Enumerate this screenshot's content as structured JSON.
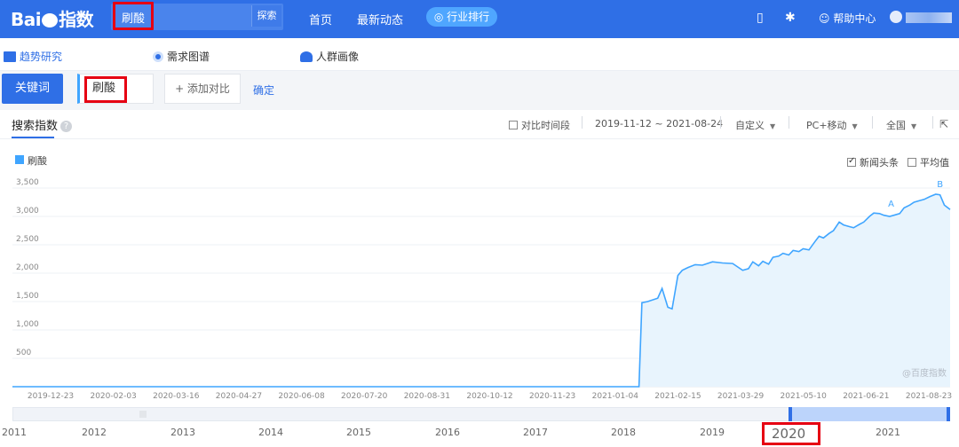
{
  "brand": {
    "logo_text": "Bai",
    "logo_suffix": "指数"
  },
  "search": {
    "value": "刷酸",
    "placeholder": "",
    "button": "探索"
  },
  "nav": {
    "home": "首页",
    "news": "最新动态",
    "rank": "行业排行",
    "help": "帮助中心"
  },
  "tabs": {
    "trend": "趋势研究",
    "demand": "需求图谱",
    "crowd": "人群画像"
  },
  "keyword_row": {
    "kw_label": "关键词",
    "kw_value": "刷酸",
    "add_compare": "+ 添加对比",
    "confirm": "确定"
  },
  "index": {
    "title": "搜索指数",
    "compare_period": "对比时间段",
    "date_range": "2019-11-12 ~ 2021-08-24",
    "custom": "自定义",
    "device": "PC+移动",
    "region": "全国"
  },
  "legend": {
    "series": "刷酸",
    "news_opt": "新闻头条",
    "avg_opt": "平均值",
    "news_checked": true,
    "avg_checked": false
  },
  "watermark": "@百度指数",
  "timeline": {
    "years": [
      "2011",
      "2012",
      "2013",
      "2014",
      "2015",
      "2016",
      "2017",
      "2018",
      "2019",
      "2020",
      "2021"
    ],
    "highlight_year": "2020"
  },
  "colors": {
    "brand_blue": "#2f6fe6",
    "series": "#3fa5ff",
    "highlight": "#e60012"
  },
  "chart_data": {
    "type": "area",
    "ylim": [
      0,
      3500
    ],
    "yticks": [
      500,
      1000,
      1500,
      2000,
      2500,
      3000,
      3500
    ],
    "ytick_labels": [
      "500",
      "1,000",
      "1,500",
      "2,000",
      "2,500",
      "3,000",
      "3,500"
    ],
    "xtick_labels": [
      "2019-12-23",
      "2020-02-03",
      "2020-03-16",
      "2020-04-27",
      "2020-06-08",
      "2020-07-20",
      "2020-08-31",
      "2020-10-12",
      "2020-11-23",
      "2021-01-04",
      "2021-02-15",
      "2021-03-29",
      "2021-05-10",
      "2021-06-21",
      "2021-08-23"
    ],
    "annotations": [
      {
        "label": "A",
        "x": "2021-07-14",
        "y": 3050
      },
      {
        "label": "B",
        "x": "2021-08-17",
        "y": 3390
      }
    ],
    "series": [
      {
        "name": "刷酸",
        "x": [
          "2019-11-12",
          "2020-01-01",
          "2020-03-01",
          "2020-05-01",
          "2020-07-01",
          "2020-09-01",
          "2020-11-01",
          "2021-01-01",
          "2021-01-15",
          "2021-01-20",
          "2021-01-22",
          "2021-01-26",
          "2021-02-02",
          "2021-02-05",
          "2021-02-09",
          "2021-02-12",
          "2021-02-16",
          "2021-02-19",
          "2021-02-23",
          "2021-02-28",
          "2021-03-05",
          "2021-03-12",
          "2021-03-19",
          "2021-03-26",
          "2021-04-02",
          "2021-04-06",
          "2021-04-09",
          "2021-04-13",
          "2021-04-16",
          "2021-04-20",
          "2021-04-23",
          "2021-04-27",
          "2021-04-30",
          "2021-05-04",
          "2021-05-07",
          "2021-05-11",
          "2021-05-14",
          "2021-05-18",
          "2021-05-22",
          "2021-05-25",
          "2021-05-28",
          "2021-06-01",
          "2021-06-04",
          "2021-06-08",
          "2021-06-11",
          "2021-06-15",
          "2021-06-18",
          "2021-06-22",
          "2021-06-25",
          "2021-06-29",
          "2021-07-02",
          "2021-07-06",
          "2021-07-09",
          "2021-07-13",
          "2021-07-16",
          "2021-07-20",
          "2021-07-23",
          "2021-07-27",
          "2021-07-30",
          "2021-08-03",
          "2021-08-06",
          "2021-08-10",
          "2021-08-14",
          "2021-08-17",
          "2021-08-20",
          "2021-08-24"
        ],
        "values": [
          0,
          0,
          0,
          0,
          0,
          0,
          0,
          0,
          0,
          0,
          1480,
          1500,
          1560,
          1730,
          1400,
          1370,
          1960,
          2050,
          2100,
          2150,
          2140,
          2200,
          2180,
          2170,
          2050,
          2080,
          2200,
          2130,
          2210,
          2160,
          2280,
          2300,
          2350,
          2320,
          2400,
          2380,
          2430,
          2410,
          2550,
          2650,
          2620,
          2700,
          2750,
          2900,
          2850,
          2820,
          2800,
          2860,
          2900,
          3000,
          3060,
          3050,
          3020,
          3000,
          3020,
          3050,
          3150,
          3200,
          3250,
          3280,
          3300,
          3350,
          3390,
          3380,
          3200,
          3120
        ]
      }
    ]
  }
}
